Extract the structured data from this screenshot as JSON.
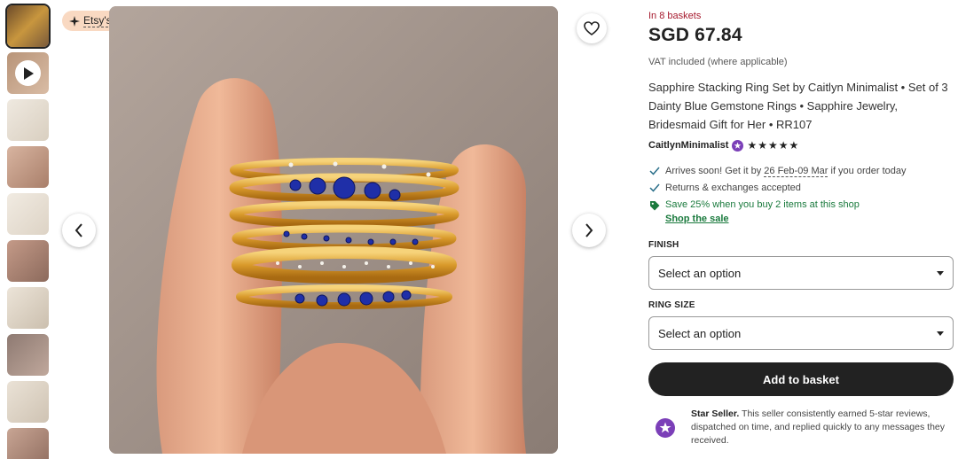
{
  "badge": {
    "label": "Etsy's Pick"
  },
  "thumbnails": [
    {
      "label": "thumbnail-1",
      "bg": "#8a6a3a"
    },
    {
      "label": "thumbnail-2",
      "bg": "#c9a88c"
    },
    {
      "label": "thumbnail-3",
      "bg": "#e4ddd2"
    },
    {
      "label": "thumbnail-4",
      "bg": "#c7a08c"
    },
    {
      "label": "thumbnail-5",
      "bg": "#e8e1d6"
    },
    {
      "label": "thumbnail-6",
      "bg": "#b08a7a"
    },
    {
      "label": "thumbnail-7",
      "bg": "#ddd2c2"
    },
    {
      "label": "thumbnail-8",
      "bg": "#a8928a"
    },
    {
      "label": "thumbnail-9",
      "bg": "#e0d8cc"
    },
    {
      "label": "thumbnail-10",
      "bg": "#c9aa98"
    }
  ],
  "product": {
    "baskets": "In 8 baskets",
    "price": "SGD 67.84",
    "vat": "VAT included (where applicable)",
    "title": "Sapphire Stacking Ring Set by Caitlyn Minimalist • Set of 3 Dainty Blue Gemstone Rings • Sapphire Jewelry, Bridesmaid Gift for Her • RR107",
    "seller": "CaitlynMinimalist",
    "stars": "★★★★★",
    "rating": 5
  },
  "perks": {
    "arrives_prefix": "Arrives soon! Get it by",
    "arrives_date": "26 Feb-09 Mar",
    "arrives_suffix": "if you order today",
    "returns": "Returns & exchanges accepted",
    "sale": "Save 25% when you buy 2 items at this shop",
    "shop_sale": "Shop the sale"
  },
  "options": {
    "finish_label": "FINISH",
    "finish_value": "Select an option",
    "ring_size_label": "RING SIZE",
    "ring_size_value": "Select an option"
  },
  "actions": {
    "add_to_basket": "Add to basket"
  },
  "star_seller": {
    "title": "Star Seller.",
    "text": "This seller consistently earned 5-star reviews, dispatched on time, and replied quickly to any messages they received."
  },
  "colors": {
    "accent_sale": "#1a7a3d",
    "baskets": "#a61a2e",
    "star_seller_badge": "#7b3fb8",
    "button": "#222222"
  }
}
